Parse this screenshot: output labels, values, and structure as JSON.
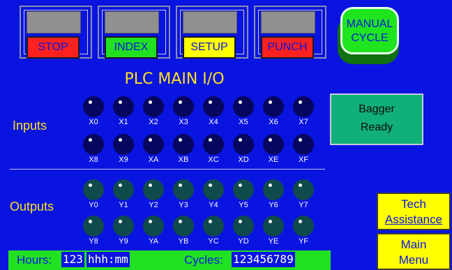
{
  "top_buttons": [
    {
      "label": "STOP",
      "bg": "#ff2020"
    },
    {
      "label": "INDEX",
      "bg": "#20e020"
    },
    {
      "label": "SETUP",
      "bg": "#ffff00"
    },
    {
      "label": "PUNCH",
      "bg": "#ff2020"
    }
  ],
  "manual_cycle": {
    "line1": "MANUAL",
    "line2": "CYCLE"
  },
  "title": "PLC MAIN I/O",
  "inputs": {
    "label": "Inputs",
    "row1": [
      "X0",
      "X1",
      "X2",
      "X3",
      "X4",
      "X5",
      "X6",
      "X7"
    ],
    "row2": [
      "X8",
      "X9",
      "XA",
      "XB",
      "XC",
      "XD",
      "XE",
      "XF"
    ]
  },
  "outputs": {
    "label": "Outputs",
    "row1": [
      "Y0",
      "Y1",
      "Y2",
      "Y3",
      "Y4",
      "Y5",
      "Y6",
      "Y7"
    ],
    "row2": [
      "Y8",
      "Y9",
      "YA",
      "YB",
      "YC",
      "YD",
      "YE",
      "YF"
    ]
  },
  "bagger": {
    "line1": "Bagger",
    "line2": "Ready"
  },
  "tech_assistance": {
    "line1": "Tech",
    "line2": "Assistance"
  },
  "main_menu": {
    "line1": "Main",
    "line2": "Menu"
  },
  "status": {
    "hours_label": "Hours:",
    "hours_value": "123",
    "hours_format": "hhh:mm",
    "cycles_label": "Cycles:",
    "cycles_value": "123456789"
  }
}
